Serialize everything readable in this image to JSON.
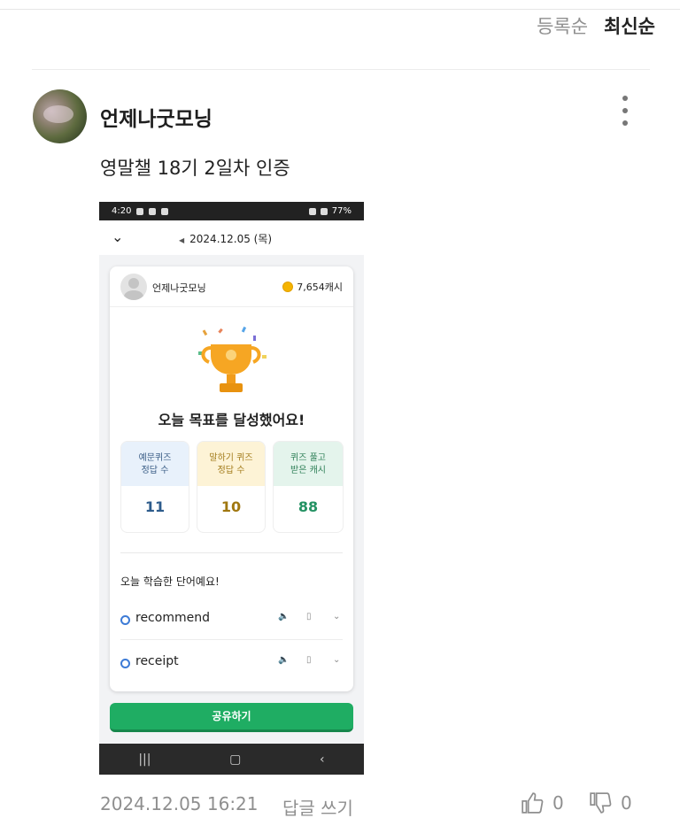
{
  "sort": {
    "options": [
      "등록순",
      "최신순"
    ],
    "active_index": 1
  },
  "post": {
    "author": "언제나굿모닝",
    "text": "영말챌 18기 2일차 인증",
    "date": "2024.12.05 16:21",
    "reply_label": "답글 쓰기",
    "likes": "0",
    "dislikes": "0"
  },
  "screenshot": {
    "status_time": "4:20",
    "battery": "77%",
    "date": "2024.12.05 (목)",
    "user": "언제나굿모닝",
    "cash": "7,654캐시",
    "goal_title": "오늘 목표를 달성했어요!",
    "stats": [
      {
        "label_1": "예문퀴즈",
        "label_2": "정답 수",
        "value": "11"
      },
      {
        "label_1": "말하기 퀴즈",
        "label_2": "정답 수",
        "value": "10"
      },
      {
        "label_1": "퀴즈 풀고",
        "label_2": "받은 캐시",
        "value": "88"
      }
    ],
    "words_title": "오늘 학습한 단어예요!",
    "words": [
      "recommend",
      "receipt"
    ],
    "share_label": "공유하기"
  },
  "colors": {
    "share_button": "#1fad63",
    "accent_blue": "#3d7bd6"
  }
}
